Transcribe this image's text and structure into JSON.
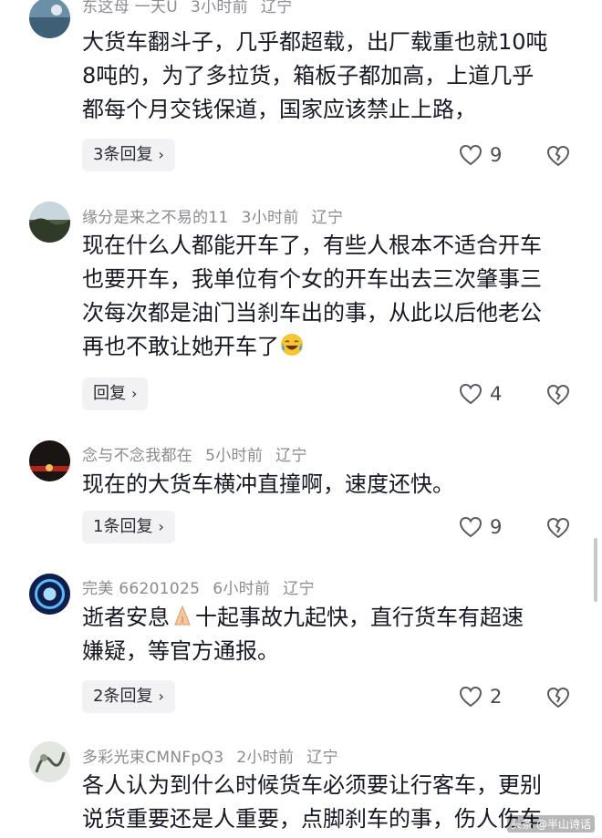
{
  "comments": [
    {
      "meta": {
        "name": "东这母 一天U",
        "time": "3小时前",
        "location": "辽宁"
      },
      "lines": [
        "大货车翻斗子，几乎都超载，出厂载重也就10吨",
        "8吨的，为了多拉货，箱板子都加高，上道几乎",
        "都每个月交钱保道，国家应该禁止上路，"
      ],
      "reply_label": "3条回复",
      "likes": "9"
    },
    {
      "meta": {
        "name": "缘分是来之不易的11",
        "time": "3小时前",
        "location": "辽宁"
      },
      "lines": [
        "现在什么人都能开车了，有些人根本不适合开车",
        "也要开车，我单位有个女的开车出去三次肇事三",
        "次每次都是油门当刹车出的事，从此以后他老公",
        "再也不敢让她开车了"
      ],
      "emoji": "laugh-cry-emoji",
      "reply_label": "回复",
      "likes": "4"
    },
    {
      "meta": {
        "name": "念与不念我都在",
        "time": "5小时前",
        "location": "辽宁"
      },
      "lines": [
        "现在的大货车横冲直撞啊，速度还快。"
      ],
      "reply_label": "1条回复",
      "likes": "9"
    },
    {
      "meta": {
        "name": "完美 66201025",
        "time": "6小时前",
        "location": "辽宁"
      },
      "lines_a": "逝者安息",
      "emoji": "pray-emoji",
      "lines_b": "十起事故九起快，直行货车有超速",
      "lines": [
        "嫌疑，等官方通报。"
      ],
      "reply_label": "2条回复",
      "likes": "2"
    },
    {
      "meta": {
        "name": "多彩光束CMNFpQ3",
        "time": "2小时前",
        "location": "辽宁"
      },
      "lines": [
        "各人认为到什么时候货车必须要让行客车，更别",
        "说货重要还是人重要，点脚刹车的事，伤人伤车"
      ]
    }
  ],
  "watermark": "头条 @半山诗话",
  "colors": {
    "text": "#161823",
    "meta": "#8a8b91",
    "reply_bg": "#f2f2f4",
    "icon": "#5a5b62"
  },
  "icons": {
    "like": "heart-outline-icon",
    "dislike": "broken-heart-icon",
    "chevron": "chevron-right-icon"
  }
}
